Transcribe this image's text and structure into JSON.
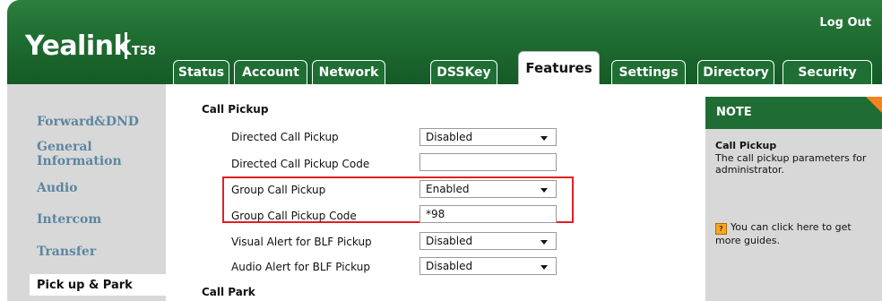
{
  "header": {
    "brand": "Yealink",
    "model": "T58",
    "logout_label": "Log Out",
    "tabs": [
      {
        "label": "Status"
      },
      {
        "label": "Account"
      },
      {
        "label": "Network"
      },
      {
        "label": "DSSKey"
      },
      {
        "label": "Features",
        "active": true
      },
      {
        "label": "Settings"
      },
      {
        "label": "Directory"
      },
      {
        "label": "Security"
      }
    ]
  },
  "sidebar": {
    "items": [
      {
        "label": "Forward&DND"
      },
      {
        "label": "General Information"
      },
      {
        "label": "Audio"
      },
      {
        "label": "Intercom"
      },
      {
        "label": "Transfer"
      },
      {
        "label": "Pick up & Park",
        "active": true
      }
    ]
  },
  "main": {
    "sections": {
      "call_pickup": "Call Pickup",
      "call_park": "Call Park"
    },
    "fields": [
      {
        "label": "Directed Call Pickup",
        "type": "select",
        "value": "Disabled"
      },
      {
        "label": "Directed Call Pickup Code",
        "type": "input",
        "value": ""
      },
      {
        "label": "Group Call Pickup",
        "type": "select",
        "value": "Enabled"
      },
      {
        "label": "Group Call Pickup Code",
        "type": "input",
        "value": "*98"
      },
      {
        "label": "Visual Alert for BLF Pickup",
        "type": "select",
        "value": "Disabled"
      },
      {
        "label": "Audio Alert for BLF Pickup",
        "type": "select",
        "value": "Disabled"
      }
    ]
  },
  "note": {
    "title": "NOTE",
    "heading": "Call Pickup",
    "text": "The call pickup parameters for administrator.",
    "guide_text": "You can click here to get more guides.",
    "guide_icon": "book-icon"
  },
  "colors": {
    "brand_green": "#1f6d34",
    "link_blue": "#5b87a0",
    "highlight_red": "#e31e24",
    "note_accent": "#f5821f"
  }
}
